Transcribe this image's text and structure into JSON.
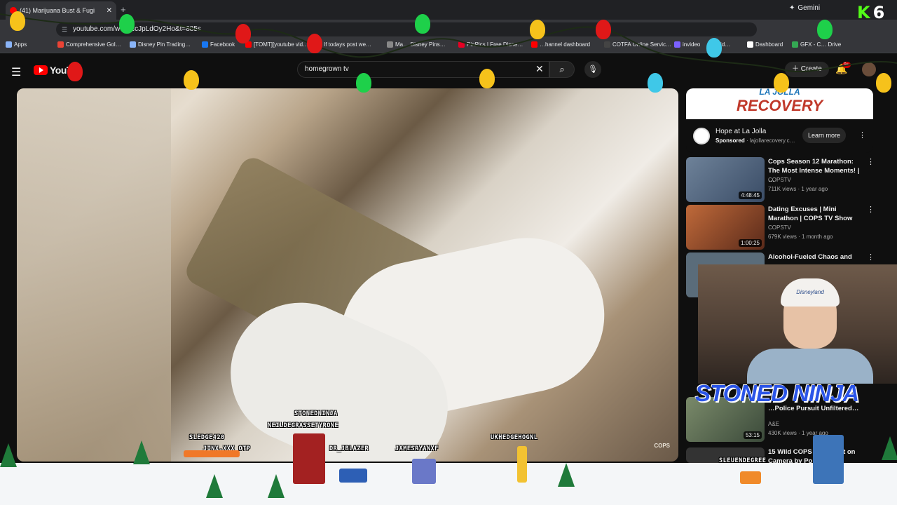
{
  "browser": {
    "tab_title": "(41) Marijuana Bust & Fugi",
    "new_tab": "+",
    "gemini_label": "Gemini",
    "url": "youtube.com/w…=ccJpLdOy2Ho&t=885s",
    "bookmarks": [
      "Apps",
      "Comprehensive Gol…",
      "Disney Pin Trading…",
      "Facebook",
      "[TOMT][youtube vid…",
      "If todays post we…",
      "Ma… Disney Pins…",
      "PinPics | Free Disne…",
      "…hannel dashboard",
      "COTFA Online Servic…",
      "invideo",
      "id…",
      "Dashboard",
      "GFX - C… Drive"
    ]
  },
  "overlay": {
    "kick_letter": "K",
    "kick_number": "6"
  },
  "youtube": {
    "logo_text": "YouT",
    "search_query": "homegrown tv",
    "create_label": "Create",
    "notif_badge": "9+",
    "video_watermark": "COPS"
  },
  "ad": {
    "banner_small": "LA JOLLA",
    "banner": "RECOVERY",
    "title": "Hope at La Jolla",
    "sponsored": "Sponsored",
    "domain": "· lajollarecovery.c…",
    "button": "Learn more"
  },
  "recommendations": [
    {
      "title": "Cops Season 12 Marathon: The Most Intense Moments! | …",
      "channel": "COPSTV",
      "meta": "711K views · 1 year ago",
      "duration": "4:48:45",
      "thumb_color": "#3a4c66"
    },
    {
      "title": "Dating Excuses | Mini Marathon | COPS TV Show",
      "channel": "COPSTV",
      "meta": "679K views · 1 month ago",
      "duration": "1:00:25",
      "thumb_color": "#8a3d2a"
    },
    {
      "title": "Alcohol-Fueled Chaos and",
      "channel": "",
      "meta": "",
      "duration": "",
      "thumb_color": "#5a6c7a"
    }
  ],
  "lower_recs": [
    {
      "title": "…Police Pursuit Unfiltered…",
      "channel": "A&E",
      "meta": "430K views · 1 year ago",
      "duration": "53:15"
    },
    {
      "title": "15 Wild COPS … Caught on Camera by Police",
      "channel": "",
      "meta": "",
      "duration": ""
    }
  ],
  "stream": {
    "ninja_text": "STONED NINJA",
    "cap_text": "Disneyland",
    "chat_names": [
      "STONEDNINJA",
      "NEILDEGRASSETYRONE",
      "SLEDGE420",
      "JINX.XXX_OTP",
      "DR_JBLAZER",
      "JAMESRYANXF",
      "UKHEDGEHOGNL",
      "SLEUENDEGREE"
    ]
  },
  "icons": [
    "search-icon",
    "mic-icon",
    "bell-icon",
    "menu-icon",
    "close-icon",
    "more-icon",
    "refresh-icon"
  ]
}
